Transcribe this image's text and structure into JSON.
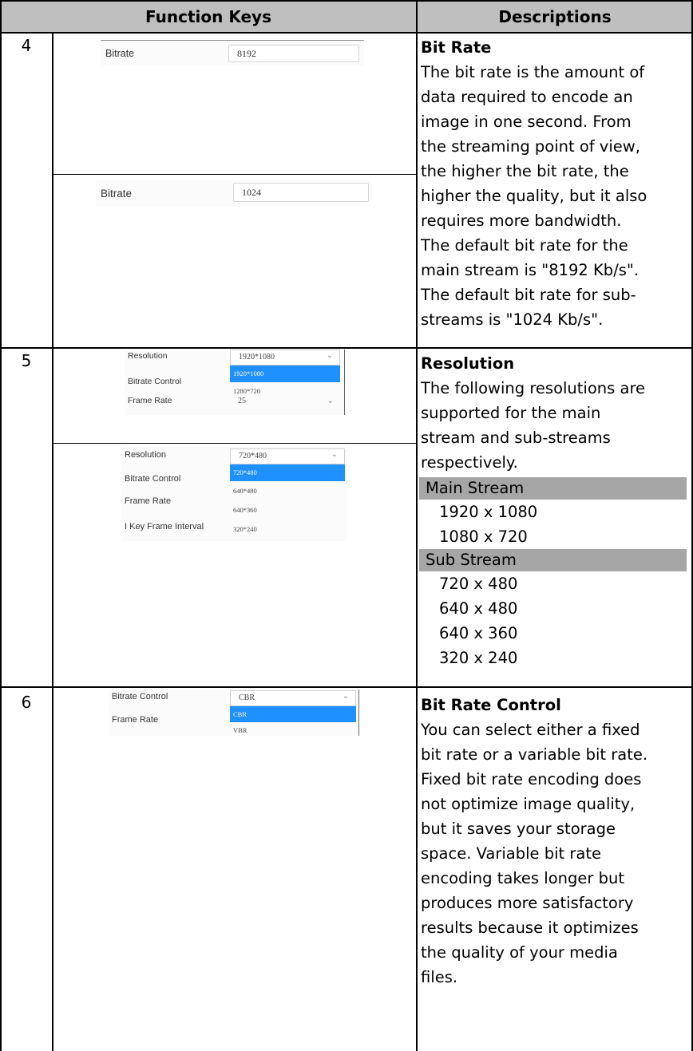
{
  "header": {
    "function_keys": "Function Keys",
    "descriptions": "Descriptions"
  },
  "rows": [
    {
      "number": "4",
      "screens": [
        {
          "label": "Bitrate",
          "value": "8192"
        },
        {
          "label": "Bitrate",
          "value": "1024"
        }
      ],
      "title": "Bit Rate",
      "lines": [
        "The bit rate is the amount of",
        "data required to encode an",
        "image in one second. From",
        "the streaming point of view,",
        "the higher the bit rate, the",
        "higher the quality, but it also",
        "requires more bandwidth.",
        "The default bit rate for the",
        "main stream is \"8192 Kb/s\".",
        "The default bit rate for sub-",
        "streams is \"1024 Kb/s\"."
      ]
    },
    {
      "number": "5",
      "screens": [
        {
          "labels": [
            "Resolution",
            "Bitrate Control",
            "Frame Rate"
          ],
          "selected": "1920*1080",
          "options": [
            "1920*1080",
            "1280*720"
          ],
          "frame_rate": "25"
        },
        {
          "labels": [
            "Resolution",
            "Bitrate Control",
            "Frame Rate",
            "I Key Frame Interval"
          ],
          "selected": "720*480",
          "options": [
            "720*480",
            "640*480",
            "640*360",
            "320*240"
          ]
        }
      ],
      "title": "Resolution",
      "lines": [
        "The following resolutions are",
        "supported for the main",
        "stream and sub-streams",
        "respectively."
      ],
      "main_stream": {
        "heading": "Main Stream",
        "items": [
          "1920 x 1080",
          "1080 x 720"
        ]
      },
      "sub_stream": {
        "heading": "Sub Stream",
        "items": [
          "720 x 480",
          "640 x 480",
          "640 x 360",
          "320 x 240"
        ]
      }
    },
    {
      "number": "6",
      "screen": {
        "labels": [
          "Bitrate Control",
          "Frame Rate"
        ],
        "selected": "CBR",
        "options": [
          "CBR",
          "VBR"
        ]
      },
      "title": "Bit Rate Control",
      "lines": [
        "You can select either a fixed",
        "bit rate or a variable bit rate.",
        "Fixed bit rate encoding does",
        "not optimize image quality,",
        "but it saves your storage",
        "space. Variable bit rate",
        "encoding takes longer but",
        "produces more satisfactory",
        "results because it optimizes",
        "the quality of your media",
        "files."
      ]
    }
  ],
  "colors": {
    "header_bg": "#bfbfbf",
    "stream_bar": "#a6a6a6",
    "selected_option": "#1e90ff"
  }
}
